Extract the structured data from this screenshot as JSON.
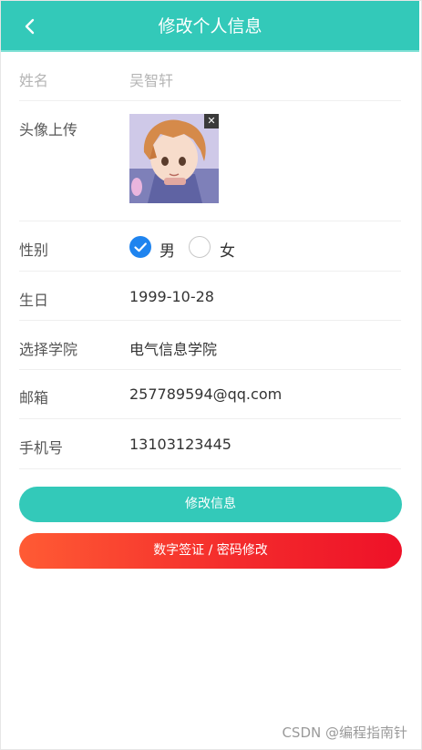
{
  "header": {
    "title": "修改个人信息"
  },
  "form": {
    "name": {
      "label": "姓名",
      "value": "吴智轩"
    },
    "avatar": {
      "label": "头像上传"
    },
    "gender": {
      "label": "性别",
      "male": "男",
      "female": "女",
      "selected": "男"
    },
    "birthday": {
      "label": "生日",
      "value": "1999-10-28"
    },
    "college": {
      "label": "选择学院",
      "value": "电气信息学院"
    },
    "email": {
      "label": "邮箱",
      "value": "257789594@qq.com"
    },
    "phone": {
      "label": "手机号",
      "value": "13103123445"
    }
  },
  "buttons": {
    "update": "修改信息",
    "signature_password": "数字签证 / 密码修改"
  },
  "watermark": "CSDN @编程指南针",
  "colors": {
    "primary": "#33c9b9",
    "radio_checked": "#1f84ef",
    "danger_start": "#ff5b34",
    "danger_end": "#ee1128"
  }
}
